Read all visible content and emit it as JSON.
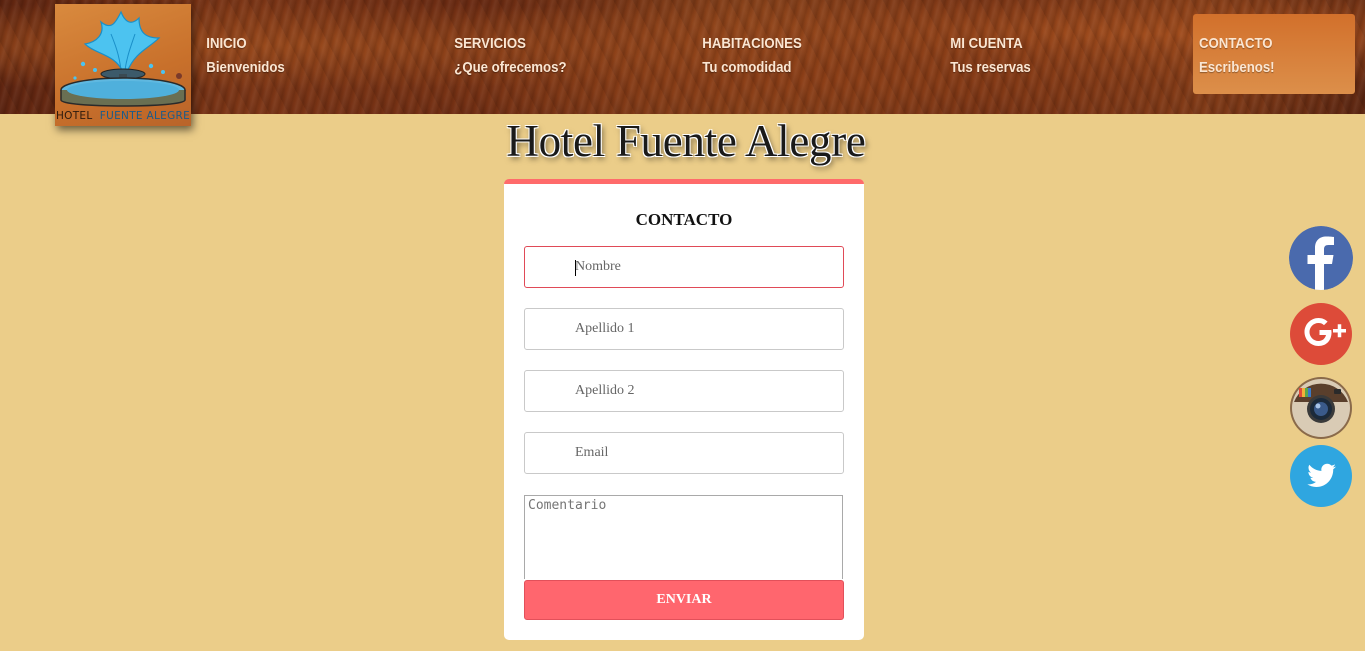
{
  "header": {
    "logo": {
      "text_part1": "HOTEL",
      "text_part2": "FUENTE ALEGRE"
    },
    "nav": [
      {
        "title": "INICIO",
        "subtitle": "Bienvenidos"
      },
      {
        "title": "SERVICIOS",
        "subtitle": "¿Que ofrecemos?"
      },
      {
        "title": "HABITACIONES",
        "subtitle": "Tu comodidad"
      },
      {
        "title": "MI CUENTA",
        "subtitle": "Tus reservas"
      },
      {
        "title": "CONTACTO",
        "subtitle": "Escribenos!"
      }
    ],
    "active_nav": "CONTACTO"
  },
  "title": "Hotel Fuente Alegre",
  "form": {
    "heading": "CONTACTO",
    "fields": {
      "nombre": {
        "placeholder": "Nombre",
        "value": ""
      },
      "apellido1": {
        "placeholder": "Apellido 1",
        "value": ""
      },
      "apellido2": {
        "placeholder": "Apellido 2",
        "value": ""
      },
      "email": {
        "placeholder": "Email",
        "value": ""
      },
      "comentario": {
        "placeholder": "Comentario",
        "value": ""
      }
    },
    "submit_label": "ENVIAR"
  },
  "social": [
    {
      "icon": "facebook-icon",
      "color": "#4a6aad"
    },
    {
      "icon": "google-plus-icon",
      "color": "#dd4b39"
    },
    {
      "icon": "instagram-icon",
      "color": "#8a6a4a"
    },
    {
      "icon": "twitter-icon",
      "color": "#2fa6e0"
    }
  ],
  "colors": {
    "page_bg": "#ebcd89",
    "accent": "#ff6b6b",
    "active_nav": "#d2702b"
  }
}
